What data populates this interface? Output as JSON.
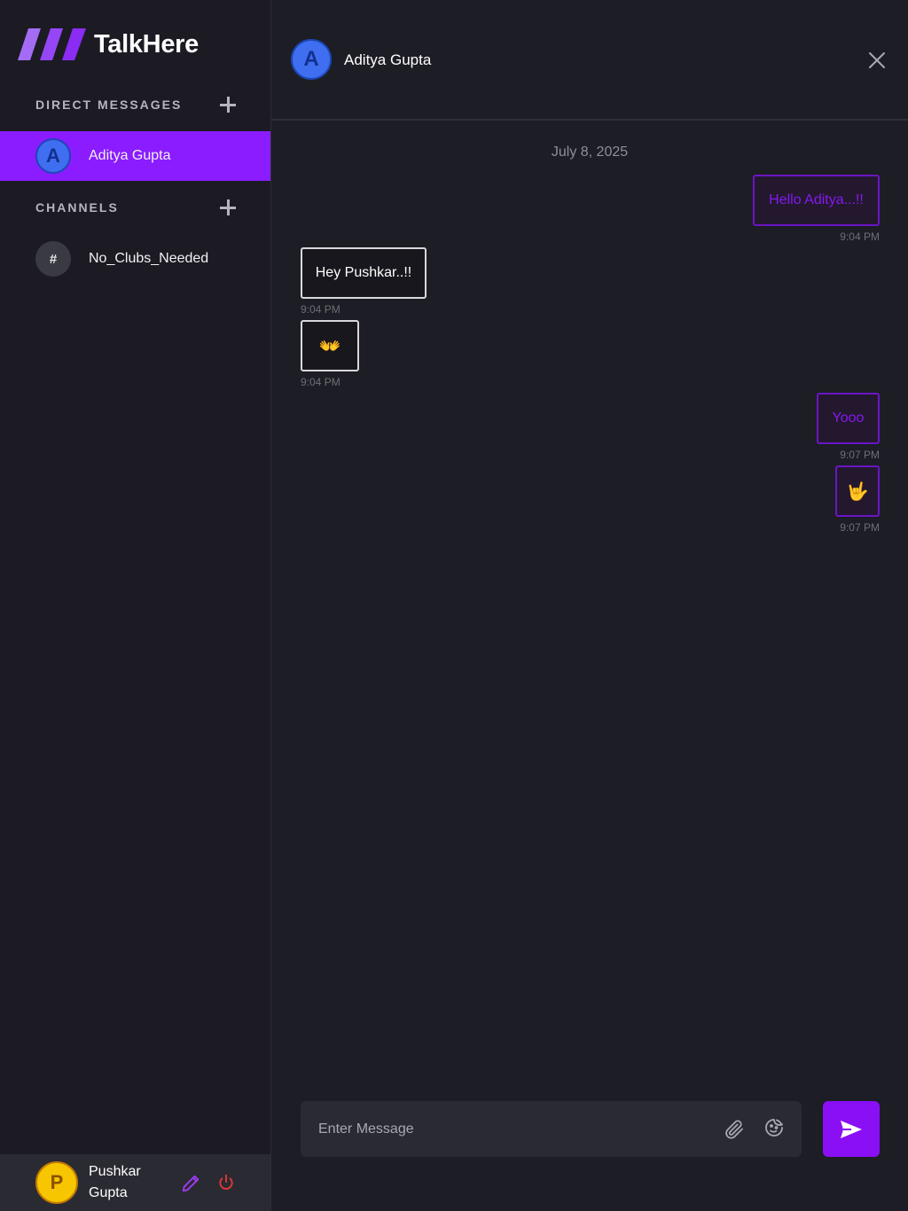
{
  "app": {
    "name": "TalkHere"
  },
  "sidebar": {
    "direct_messages_title": "DIRECT MESSAGES",
    "channels_title": "CHANNELS",
    "contacts": [
      {
        "initial": "A",
        "name": "Aditya Gupta",
        "active": true
      }
    ],
    "channels": [
      {
        "icon": "#",
        "name": "No_Clubs_Needed"
      }
    ]
  },
  "current_user": {
    "initial": "P",
    "name": "Pushkar Gupta"
  },
  "chat": {
    "contact_initial": "A",
    "contact_name": "Aditya Gupta",
    "date": "July 8, 2025",
    "messages": [
      {
        "direction": "sent",
        "text": "Hello Aditya...!!",
        "time": "9:04 PM"
      },
      {
        "direction": "received",
        "text": "Hey Pushkar..!!",
        "time": "9:04 PM"
      },
      {
        "direction": "received",
        "text": "👐",
        "time": "9:04 PM"
      },
      {
        "direction": "sent",
        "text": "Yooo",
        "time": "9:07 PM"
      },
      {
        "direction": "sent",
        "text": "🤟",
        "time": "9:07 PM"
      }
    ]
  },
  "composer": {
    "placeholder": "Enter Message"
  },
  "colors": {
    "accent": "#8a1cff",
    "background": "#1d1d25",
    "sidebar": "#1c1b24",
    "sent_text": "#8419f0",
    "avatar_blue": "#3f6ff0",
    "avatar_yellow": "#f7c600",
    "logout_red": "#e53935"
  },
  "icons": [
    "brand-logo",
    "plus-icon",
    "close-icon",
    "paperclip-icon",
    "sticker-icon",
    "send-icon",
    "pencil-icon",
    "power-icon"
  ]
}
